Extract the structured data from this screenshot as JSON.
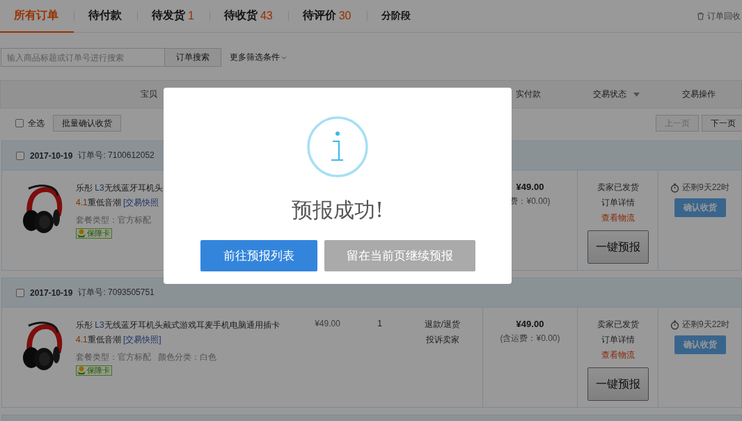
{
  "tabs": [
    {
      "label": "所有订单",
      "kind": "status",
      "selected": true
    },
    {
      "label": "待付款",
      "kind": "status",
      "selected": false
    },
    {
      "label": "待发货",
      "count": "1",
      "kind": "status",
      "selected": false
    },
    {
      "label": "待收货",
      "count": "43",
      "kind": "status",
      "selected": false
    },
    {
      "label": "待评价",
      "count": "30",
      "kind": "status",
      "selected": false
    },
    {
      "label": "分阶段",
      "kind": "stage",
      "selected": false
    }
  ],
  "recycle_link": "订单回收",
  "search": {
    "placeholder": "输入商品标题或订单号进行搜索",
    "button": "订单搜索",
    "more_filters": "更多筛选条件"
  },
  "table_header": {
    "columns": [
      {
        "label": "宝贝"
      },
      {
        "label": "实付款"
      },
      {
        "label": "交易状态",
        "sortable": true
      },
      {
        "label": "交易操作"
      }
    ]
  },
  "toolbar": {
    "select_all": {
      "label": "全选",
      "checked": false
    },
    "batch_button": "批量确认收货",
    "prev_page": {
      "label": "上一页",
      "disabled": true
    },
    "next_page": {
      "label": "下一页",
      "disabled": false
    }
  },
  "orders": [
    {
      "checked": false,
      "date": "2017-10-19",
      "order_no": "订单号: 7100612052",
      "product": {
        "image": {
          "kind": "picture"
        },
        "title_lines": [
          [
            {
              "text": "乐彤 ",
              "kind": "plain"
            },
            {
              "text": "L3",
              "kind": "model"
            },
            {
              "text": "无线蓝牙耳机头",
              "kind": "plain"
            }
          ],
          [
            {
              "text": "4.1",
              "kind": "version"
            },
            {
              "text": "重低音潮 ",
              "kind": "plain"
            },
            {
              "text": "[交易快照",
              "kind": "link"
            }
          ]
        ],
        "specs": "套餐类型：官方标配",
        "badge": "保障卡"
      },
      "total": "¥49.00",
      "shipping": "费：¥0.00)",
      "status_lines": [
        "卖家已发货",
        "订单详情"
      ],
      "logistics_link": "查看物流",
      "report_button": "一键预报",
      "countdown": "还剩9天22时",
      "confirm_button": "确认收货"
    },
    {
      "checked": false,
      "date": "2017-10-19",
      "order_no": "订单号: 7093505751",
      "product": {
        "image": {
          "kind": "picture"
        },
        "title_lines": [
          [
            {
              "text": "乐彤 ",
              "kind": "plain"
            },
            {
              "text": "L3",
              "kind": "model"
            },
            {
              "text": "无线蓝牙耳机头戴式游戏耳麦手机电脑通用插卡",
              "kind": "plain"
            }
          ],
          [
            {
              "text": "4.1",
              "kind": "version"
            },
            {
              "text": "重低音潮 ",
              "kind": "plain"
            },
            {
              "text": "[交易快照]",
              "kind": "link"
            }
          ]
        ],
        "specs": "套餐类型：官方标配   颜色分类：白色",
        "badge": "保障卡"
      },
      "price": "¥49.00",
      "quantity": "1",
      "after_sale": [
        "退款/退货",
        "投诉卖家"
      ],
      "total": "¥49.00",
      "shipping": "(含运费：¥0.00)",
      "status_lines": [
        "卖家已发货",
        "订单详情"
      ],
      "logistics_link": "查看物流",
      "report_button": "一键预报",
      "countdown": "还剩9天22时",
      "confirm_button": "确认收货"
    }
  ],
  "dialog": {
    "title": "预报成功!",
    "buttons": [
      {
        "label": "前往预报列表",
        "kind": "primary"
      },
      {
        "label": "留在当前页继续预报",
        "kind": "secondary"
      }
    ]
  }
}
